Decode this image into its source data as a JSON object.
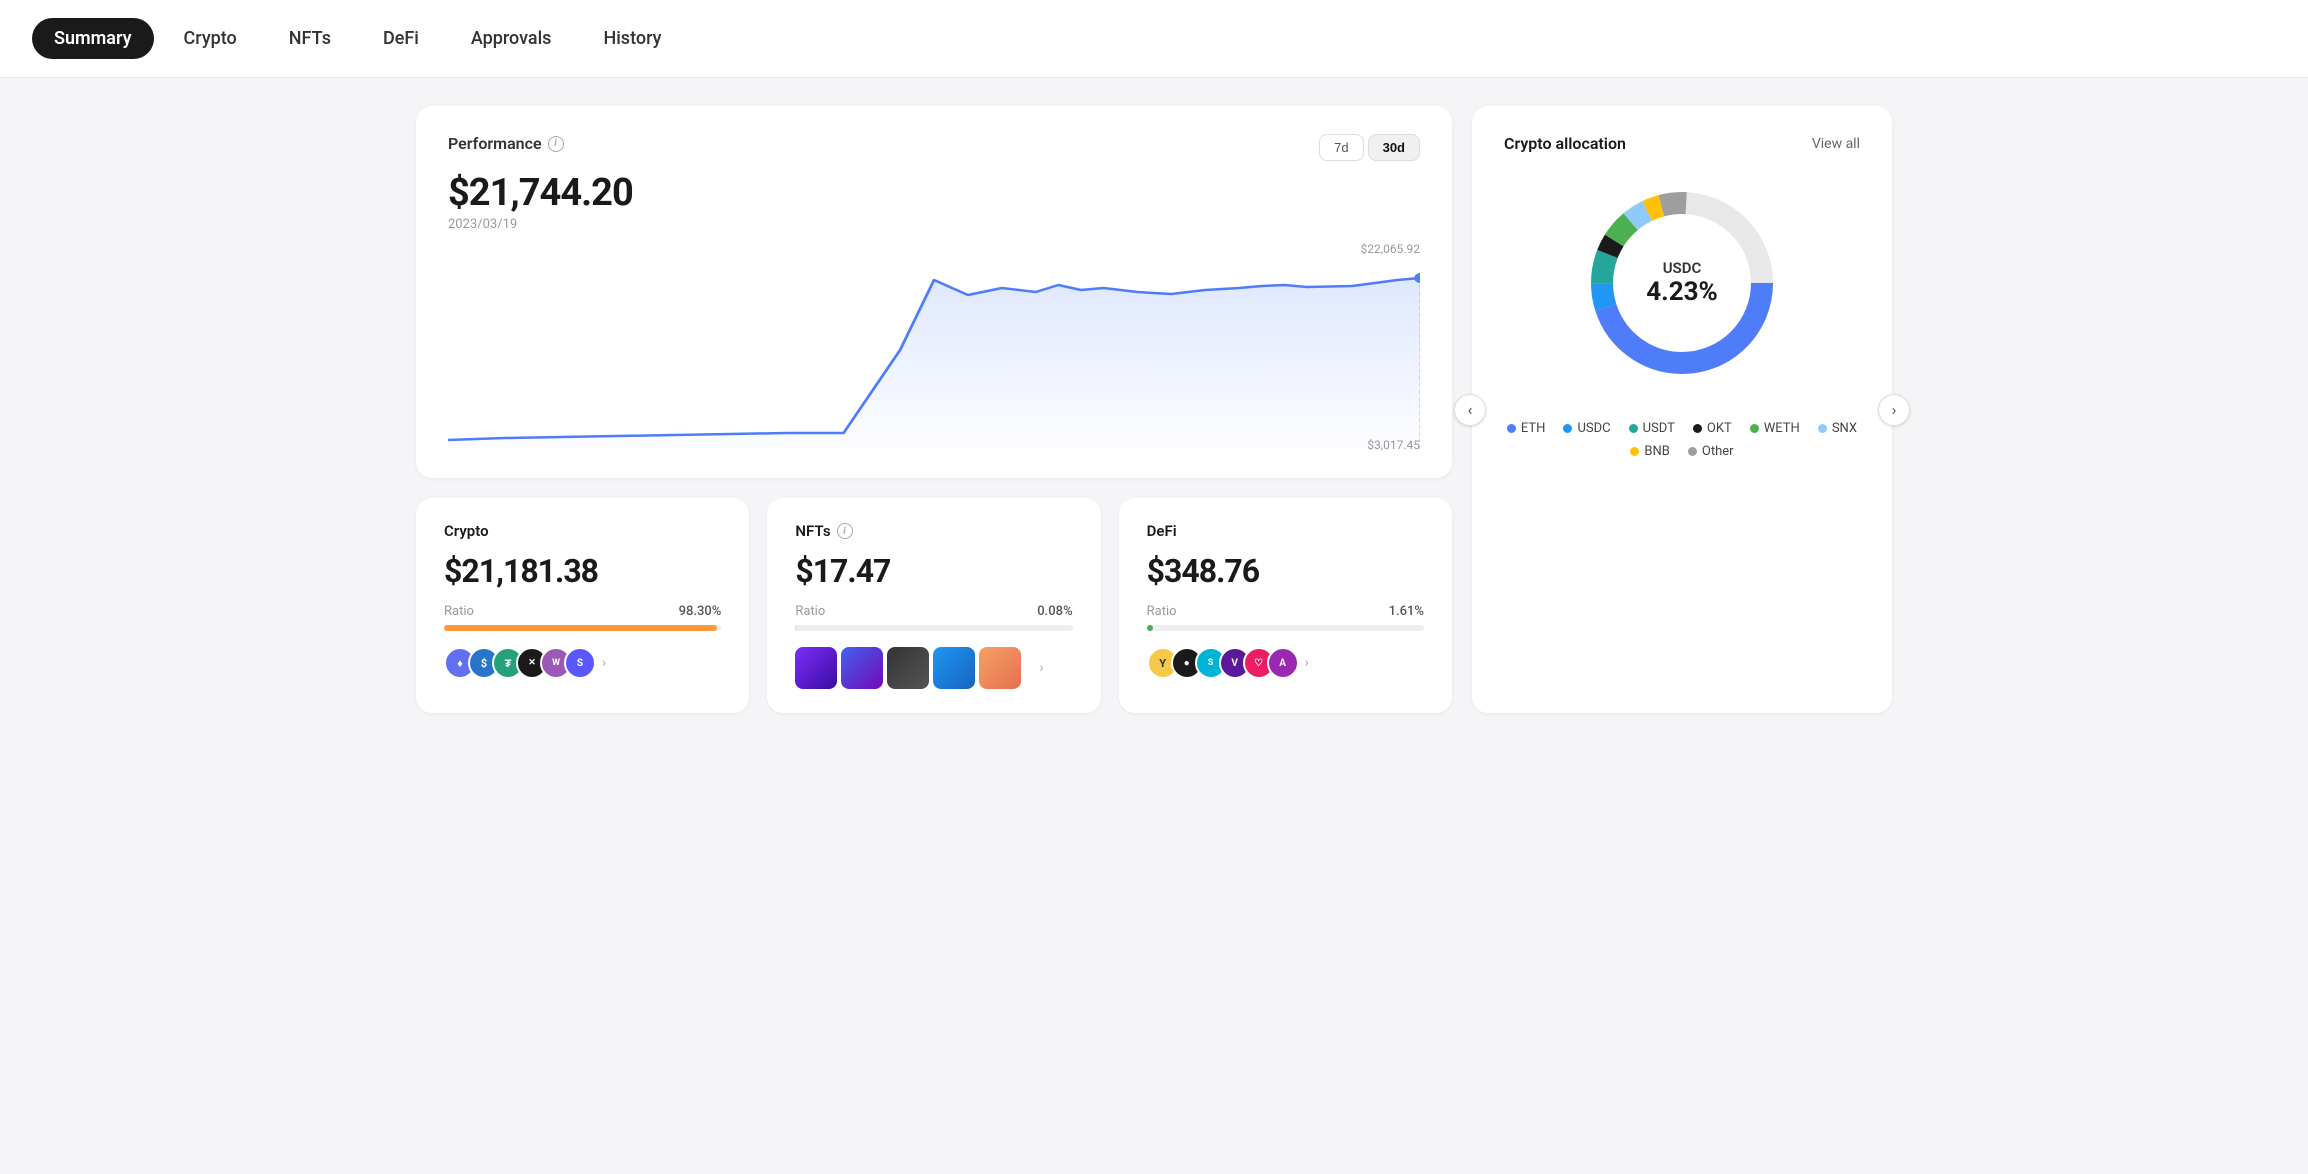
{
  "nav": {
    "items": [
      {
        "label": "Summary",
        "active": true
      },
      {
        "label": "Crypto",
        "active": false
      },
      {
        "label": "NFTs",
        "active": false
      },
      {
        "label": "DeFi",
        "active": false
      },
      {
        "label": "Approvals",
        "active": false
      },
      {
        "label": "History",
        "active": false
      }
    ]
  },
  "performance": {
    "title": "Performance",
    "amount": "$21,744.20",
    "date": "2023/03/19",
    "high_label": "$22,065.92",
    "low_label": "$3,017.45",
    "time_buttons": [
      {
        "label": "7d",
        "active": false
      },
      {
        "label": "30d",
        "active": true
      }
    ]
  },
  "allocation": {
    "title": "Crypto allocation",
    "view_all": "View all",
    "center_label": "USDC",
    "center_pct": "4.23%",
    "legend": [
      {
        "label": "ETH",
        "color": "#4f7df9"
      },
      {
        "label": "USDC",
        "color": "#2196f3"
      },
      {
        "label": "USDT",
        "color": "#26a69a"
      },
      {
        "label": "OKT",
        "color": "#1a1a1a"
      },
      {
        "label": "WETH",
        "color": "#4caf50"
      },
      {
        "label": "SNX",
        "color": "#90caf9"
      },
      {
        "label": "BNB",
        "color": "#ffc107"
      },
      {
        "label": "Other",
        "color": "#9e9e9e"
      }
    ]
  },
  "crypto_card": {
    "title": "Crypto",
    "amount": "$21,181.38",
    "ratio_label": "Ratio",
    "ratio_value": "98.30%",
    "bar_color": "#ff9a3c",
    "bar_pct": 98.3
  },
  "nfts_card": {
    "title": "NFTs",
    "amount": "$17.47",
    "ratio_label": "Ratio",
    "ratio_value": "0.08%",
    "bar_color": "#e0e0e0",
    "bar_pct": 0.08
  },
  "defi_card": {
    "title": "DeFi",
    "amount": "$348.76",
    "ratio_label": "Ratio",
    "ratio_value": "1.61%",
    "bar_color": "#4caf50",
    "bar_pct": 1.61
  }
}
